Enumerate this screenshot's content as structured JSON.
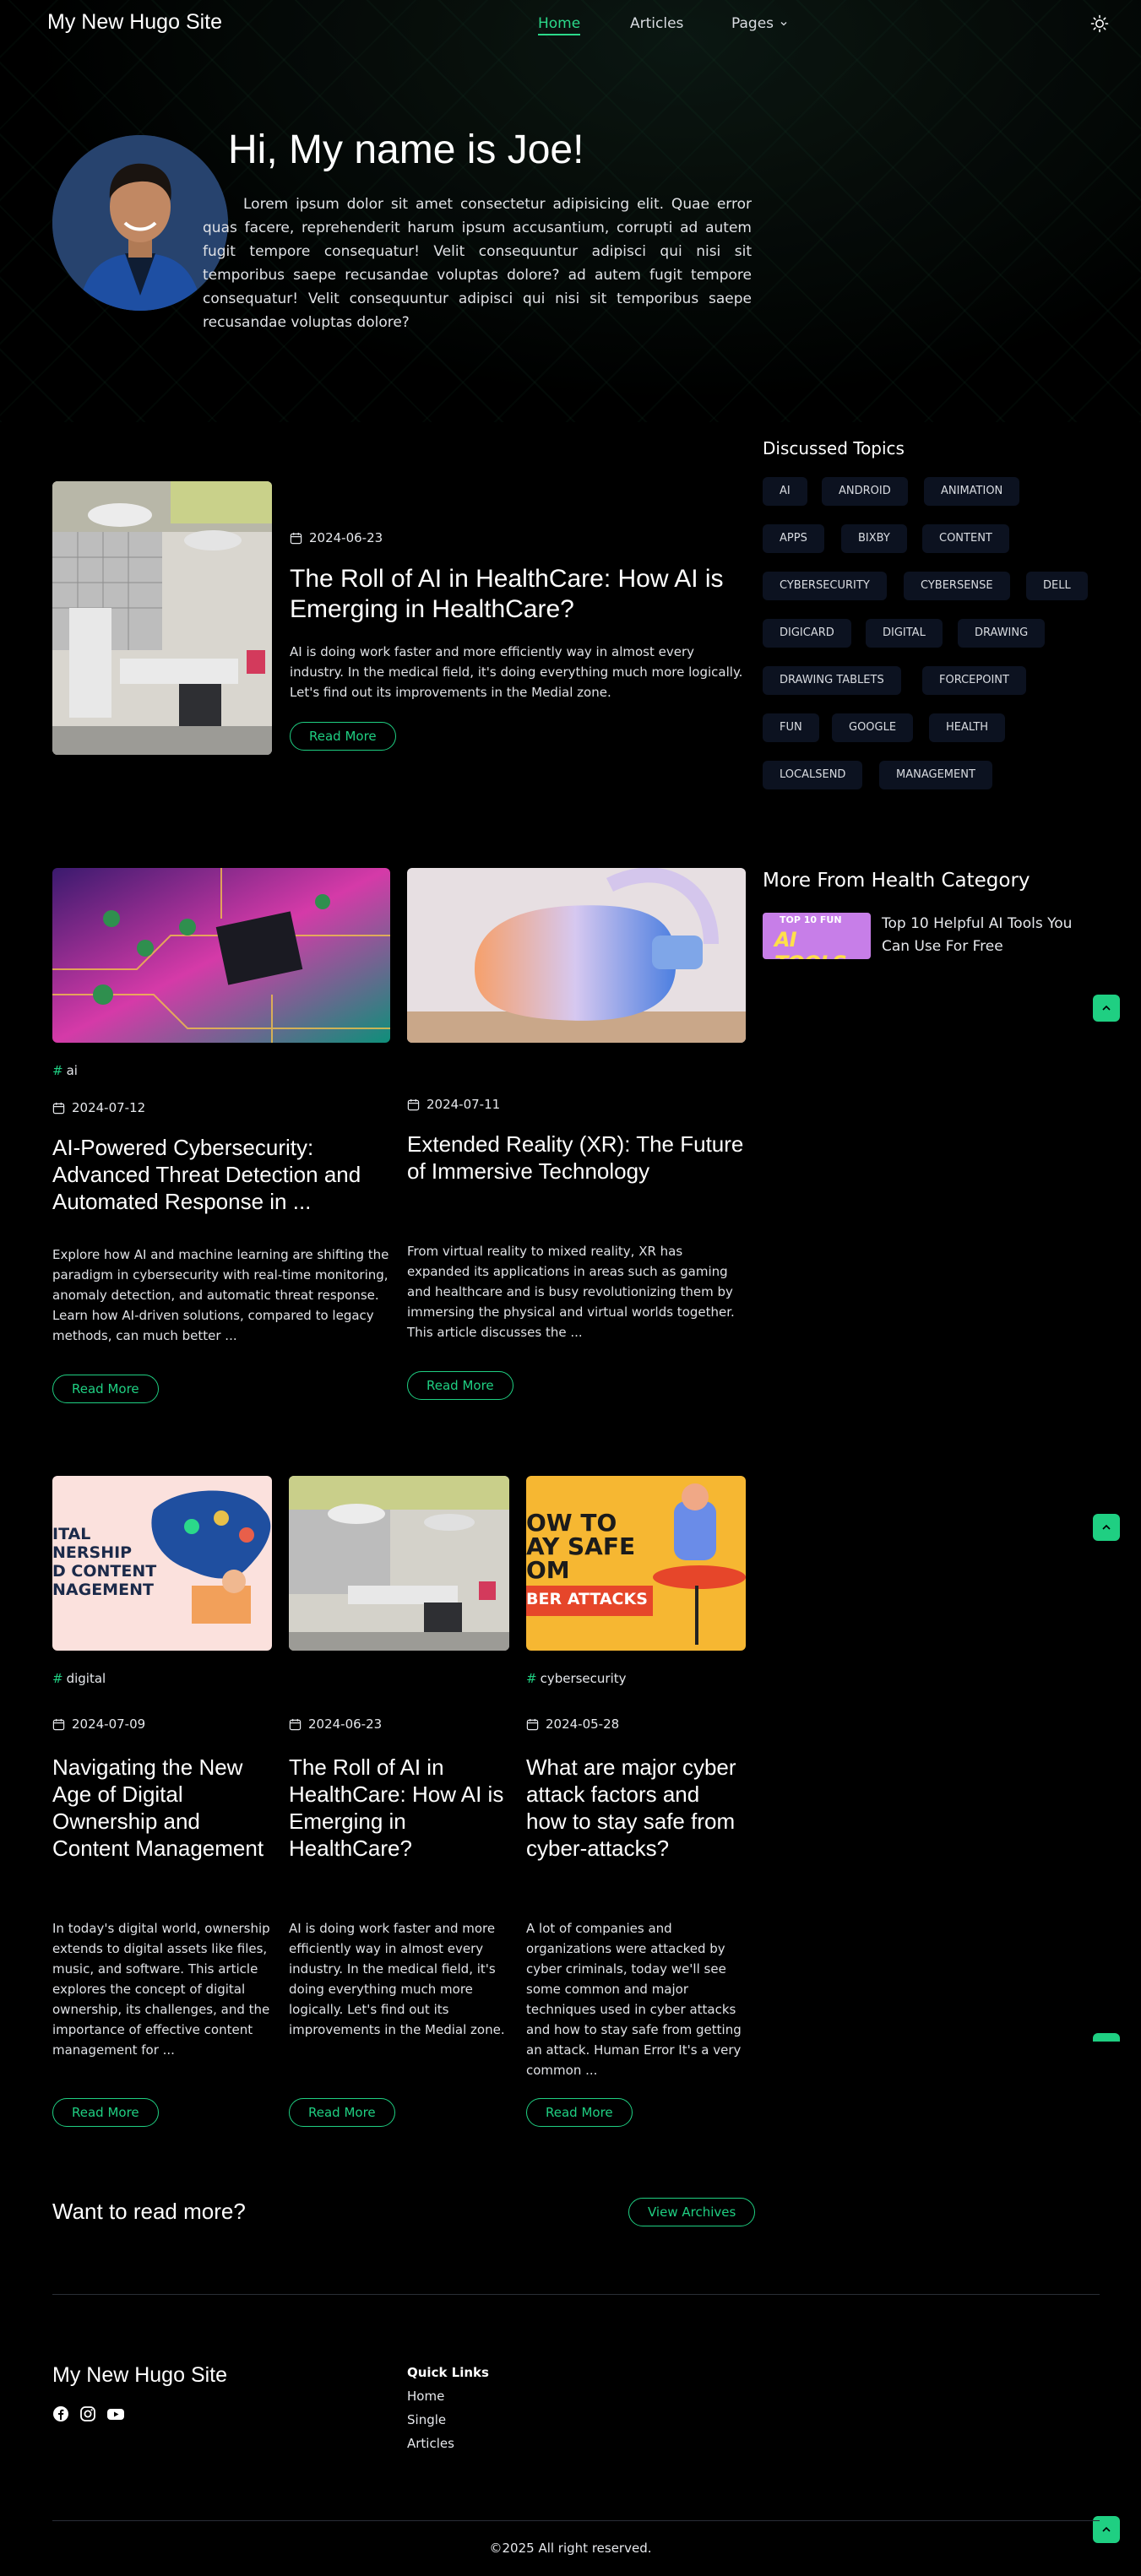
{
  "header": {
    "brand": "My New Hugo Site",
    "nav": [
      {
        "label": "Home",
        "active": true
      },
      {
        "label": "Articles",
        "active": false
      },
      {
        "label": "Pages",
        "active": false
      }
    ]
  },
  "hero": {
    "title": "Hi, My name is Joe!",
    "text": "Lorem ipsum dolor sit amet consectetur adipisicing elit. Quae error quas facere, reprehenderit harum ipsum accusantium, corrupti ad autem fugit tempore consequatur! Velit consequuntur adipisci qui nisi sit temporibus saepe recusandae voluptas dolore? ad autem fugit tempore consequatur! Velit consequuntur adipisci qui nisi sit temporibus saepe recusandae voluptas dolore?"
  },
  "featured": {
    "date": "2024-06-23",
    "title": "The Roll of AI in HealthCare: How AI is Emerging in HealthCare?",
    "text": "AI is doing work faster and more efficiently way in almost every industry. In the medical field, it's doing everything much more logically. Let's find out its improvements in the Medial zone.",
    "button": "Read More"
  },
  "sidebar": {
    "topics_heading": "Discussed Topics",
    "topics": [
      "AI",
      "ANDROID",
      "ANIMATION",
      "APPS",
      "BIXBY",
      "CONTENT",
      "CYBERSECURITY",
      "CYBERSENSE",
      "DELL",
      "DIGICARD",
      "DIGITAL",
      "DRAWING",
      "DRAWING TABLETS",
      "FORCEPOINT",
      "FUN",
      "GOOGLE",
      "HEALTH",
      "LOCALSEND",
      "MANAGEMENT"
    ],
    "more_heading": "More From Health Category",
    "more_item": {
      "title": "Top 10 Helpful AI Tools You Can Use For Free",
      "thumb_top": "TOP 10 FUN",
      "thumb_bottom": "AI TOOLS"
    }
  },
  "row2": [
    {
      "tag": "ai",
      "date": "2024-07-12",
      "title": "AI-Powered Cybersecurity: Advanced Threat Detection and Automated Response in ...",
      "text": "Explore how AI and machine learning are shifting the paradigm in cybersecurity with real-time monitoring, anomaly detection, and automatic threat response. Learn how AI-driven solutions, compared to legacy methods, can much better ...",
      "button": "Read More"
    },
    {
      "tag": "",
      "date": "2024-07-11",
      "title": "Extended Reality (XR): The Future of Immersive Technology",
      "text": "From virtual reality to mixed reality, XR has expanded its applications in areas such as gaming and healthcare and is busy revolutionizing them by immersing the physical and virtual worlds together. This article discusses the ...",
      "button": "Read More"
    }
  ],
  "row3": [
    {
      "tag": "digital",
      "date": "2024-07-09",
      "title": "Navigating the New Age of Digital Ownership and Content Management",
      "text": "In today's digital world, ownership extends to digital assets like files, music, and software. This article explores the concept of digital ownership, its challenges, and the importance of effective content management for ...",
      "button": "Read More",
      "thumb_lines": [
        "ITAL",
        "NERSHIP",
        "D CONTENT",
        "NAGEMENT"
      ]
    },
    {
      "tag": "",
      "date": "2024-06-23",
      "title": "The Roll of AI in HealthCare: How AI is Emerging in HealthCare?",
      "text": "AI is doing work faster and more efficiently way in almost every industry. In the medical field, it's doing everything much more logically. Let's find out its improvements in the Medial zone.",
      "button": "Read More"
    },
    {
      "tag": "cybersecurity",
      "date": "2024-05-28",
      "title": "What are major cyber attack factors and how to stay safe from cyber-attacks?",
      "text": "A lot of companies and organizations were attacked by cyber criminals, today we'll see some common and major techniques used in cyber attacks and how to stay safe from getting an attack. Human Error It's a very common ...",
      "button": "Read More",
      "thumb_lines": [
        "OW TO",
        "AY SAFE",
        "OM",
        "BER ATTACKS"
      ]
    }
  ],
  "cta": {
    "text": "Want to read more?",
    "button": "View Archives"
  },
  "footer": {
    "brand": "My New Hugo Site",
    "quick_links_heading": "Quick Links",
    "links": [
      "Home",
      "Single",
      "Articles"
    ],
    "copyright": "©2025 All right reserved."
  },
  "colors": {
    "accent": "#1fcf82",
    "pill_bg": "#0c1220",
    "background": "#000000"
  }
}
